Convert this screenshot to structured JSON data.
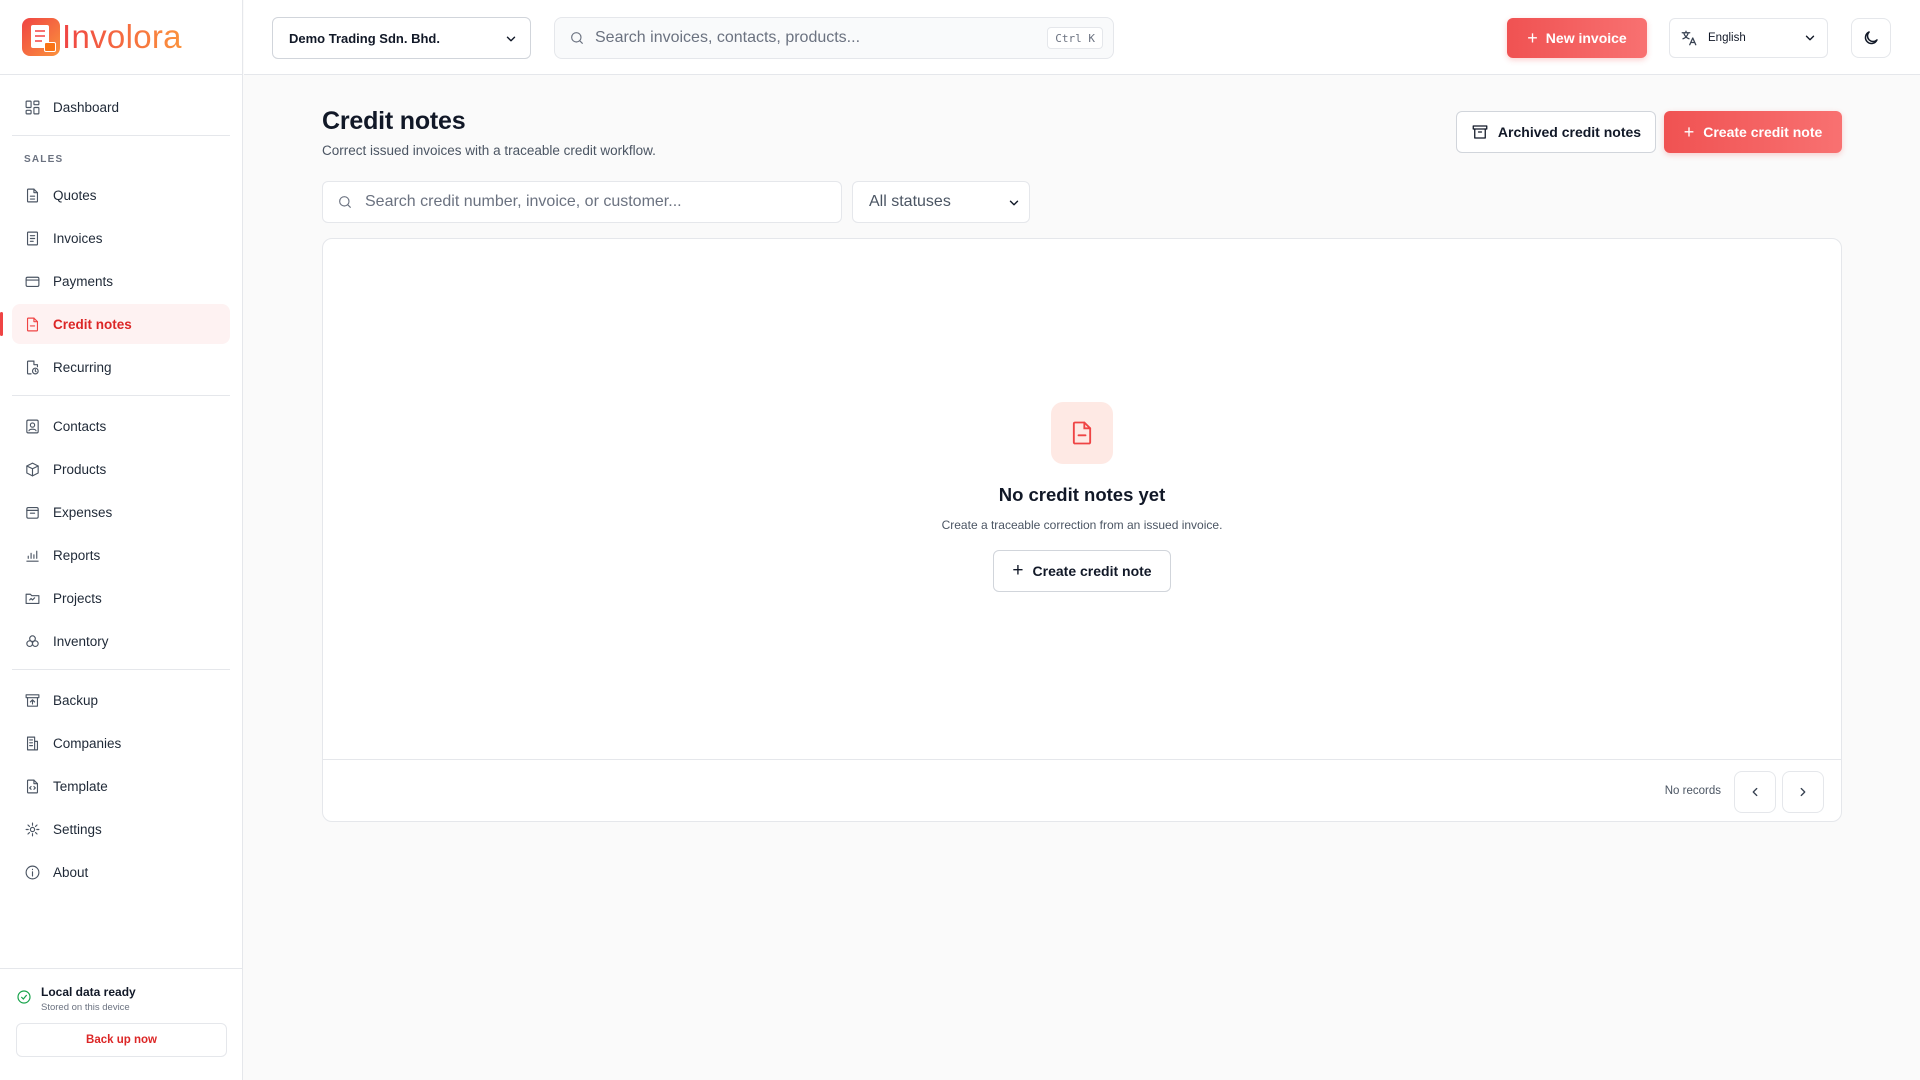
{
  "app": {
    "name": "Involora"
  },
  "topbar": {
    "company": "Demo Trading Sdn. Bhd.",
    "search_placeholder": "Search invoices, contacts, products...",
    "search_shortcut": "Ctrl K",
    "new_invoice": "New invoice",
    "language": "English"
  },
  "sidebar": {
    "dashboard": "Dashboard",
    "section_sales": "SALES",
    "items": {
      "quotes": "Quotes",
      "invoices": "Invoices",
      "payments": "Payments",
      "credit_notes": "Credit notes",
      "recurring": "Recurring",
      "contacts": "Contacts",
      "products": "Products",
      "expenses": "Expenses",
      "reports": "Reports",
      "projects": "Projects",
      "inventory": "Inventory",
      "backup": "Backup",
      "companies": "Companies",
      "template": "Template",
      "settings": "Settings",
      "about": "About"
    },
    "active": "credit_notes",
    "footer": {
      "status_title": "Local data ready",
      "status_sub": "Stored on this device",
      "backup_button": "Back up now"
    }
  },
  "page": {
    "title": "Credit notes",
    "subtitle": "Correct issued invoices with a traceable credit workflow.",
    "archived_button": "Archived credit notes",
    "create_button": "Create credit note",
    "search_placeholder": "Search credit number, invoice, or customer...",
    "status_filter": "All statuses",
    "empty": {
      "title": "No credit notes yet",
      "subtitle": "Create a traceable correction from an issued invoice.",
      "button": "Create credit note"
    },
    "pagination": {
      "summary": "No records"
    }
  },
  "colors": {
    "accent": "#ef4444",
    "accent_light": "#fef2f2",
    "success": "#16a34a"
  }
}
